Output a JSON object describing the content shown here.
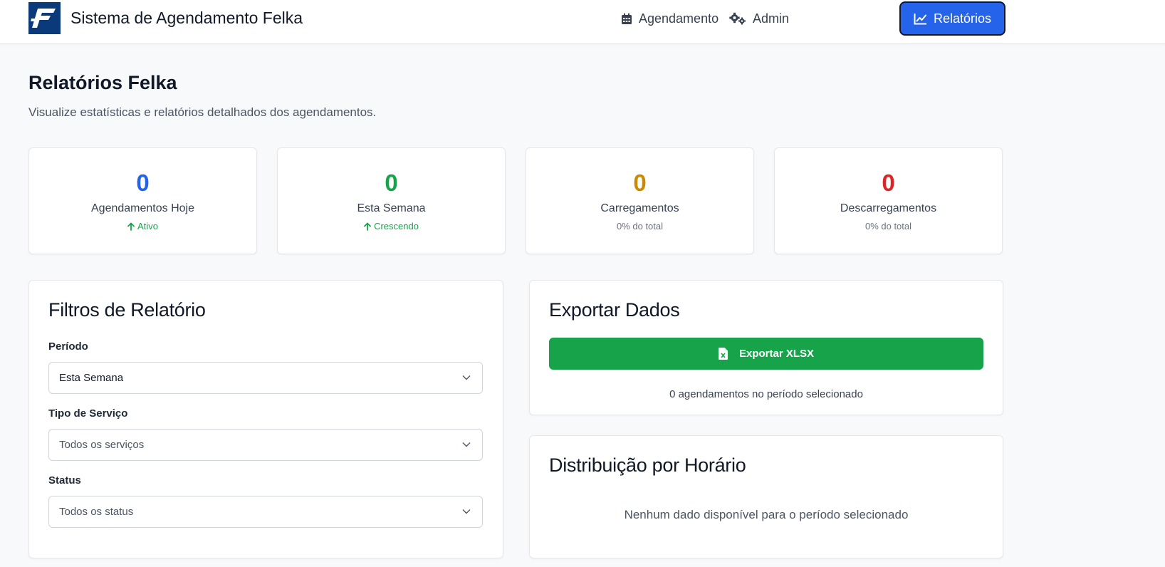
{
  "header": {
    "app_title": "Sistema de Agendamento Felka",
    "nav": [
      {
        "label": "Agendamento",
        "icon": "calendar-icon"
      },
      {
        "label": "Admin",
        "icon": "gears-icon"
      },
      {
        "label": "Relatórios",
        "icon": "chart-line-icon",
        "active": true
      }
    ]
  },
  "page": {
    "title": "Relatórios Felka",
    "subtitle": "Visualize estatísticas e relatórios detalhados dos agendamentos."
  },
  "stats": [
    {
      "value": "0",
      "label": "Agendamentos Hoje",
      "trend": "Ativo",
      "color": "#2563eb"
    },
    {
      "value": "0",
      "label": "Esta Semana",
      "trend": "Crescendo",
      "color": "#16a34a"
    },
    {
      "value": "0",
      "label": "Carregamentos",
      "trend": "0% do total",
      "color": "#ca8a04"
    },
    {
      "value": "0",
      "label": "Descarregamentos",
      "trend": "0% do total",
      "color": "#dc2626"
    }
  ],
  "filters": {
    "title": "Filtros de Relatório",
    "period_label": "Período",
    "period_value": "Esta Semana",
    "service_label": "Tipo de Serviço",
    "service_placeholder": "Todos os serviços",
    "status_label": "Status",
    "status_placeholder": "Todos os status"
  },
  "export": {
    "title": "Exportar Dados",
    "button_label": "Exportar XLSX",
    "info": "0 agendamentos no período selecionado"
  },
  "distribution": {
    "title": "Distribuição por Horário",
    "empty": "Nenhum dado disponível para o período selecionado"
  },
  "colors": {
    "accent": "#2563eb",
    "export_green": "#16a34a",
    "trend_green": "#16a34a"
  }
}
